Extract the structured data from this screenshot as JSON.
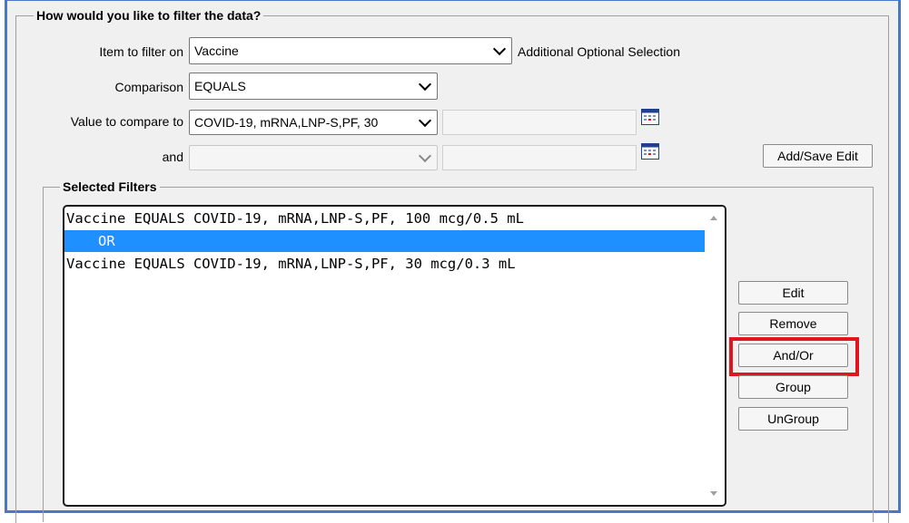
{
  "filter_section": {
    "legend": "How would you like to filter the data?",
    "item_label": "Item to filter on",
    "item_value": "Vaccine",
    "additional_label": "Additional Optional Selection",
    "comparison_label": "Comparison",
    "comparison_value": "EQUALS",
    "value_label": "Value to compare to",
    "value_value": "COVID-19, mRNA,LNP-S,PF, 30",
    "and_label": "and",
    "and_value": "",
    "add_save_button": "Add/Save Edit"
  },
  "selected_filters": {
    "legend": "Selected Filters",
    "rows": [
      "Vaccine EQUALS COVID-19, mRNA,LNP-S,PF, 100 mcg/0.5 mL",
      "OR",
      "Vaccine EQUALS COVID-19, mRNA,LNP-S,PF, 30 mcg/0.3 mL"
    ],
    "selected_index": 1
  },
  "action_buttons": {
    "edit": "Edit",
    "remove": "Remove",
    "and_or": "And/Or",
    "group": "Group",
    "ungroup": "UnGroup"
  },
  "colors": {
    "frame_border": "#4a78c9",
    "panel_bg": "#f0f0f0",
    "selection": "#1e90ff",
    "callout": "#e0151d"
  }
}
